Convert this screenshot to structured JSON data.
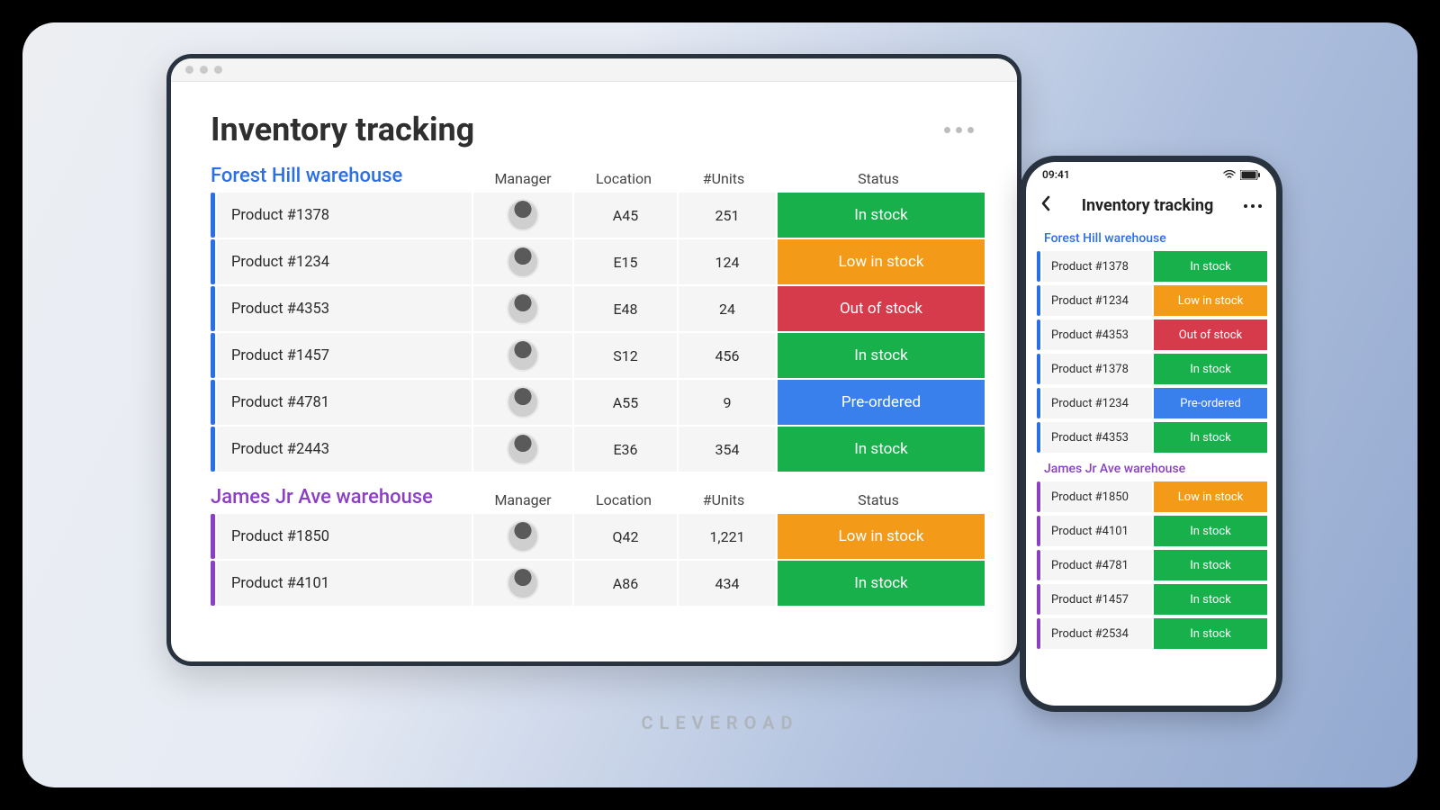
{
  "desktop": {
    "title": "Inventory tracking",
    "columns": {
      "manager": "Manager",
      "location": "Location",
      "units": "#Units",
      "status": "Status"
    },
    "sections": [
      {
        "title": "Forest Hill warehouse",
        "accent": "blue",
        "rows": [
          {
            "name": "Product  #1378",
            "location": "A45",
            "units": "251",
            "status": "In stock",
            "status_class": "instock"
          },
          {
            "name": "Product  #1234",
            "location": "E15",
            "units": "124",
            "status": "Low in stock",
            "status_class": "low"
          },
          {
            "name": "Product  #4353",
            "location": "E48",
            "units": "24",
            "status": "Out of stock",
            "status_class": "out"
          },
          {
            "name": "Product  #1457",
            "location": "S12",
            "units": "456",
            "status": "In stock",
            "status_class": "instock"
          },
          {
            "name": "Product  #4781",
            "location": "A55",
            "units": "9",
            "status": "Pre-ordered",
            "status_class": "pre"
          },
          {
            "name": "Product  #2443",
            "location": "E36",
            "units": "354",
            "status": "In stock",
            "status_class": "instock"
          }
        ]
      },
      {
        "title": "James Jr Ave warehouse",
        "accent": "purple",
        "rows": [
          {
            "name": "Product  #1850",
            "location": "Q42",
            "units": "1,221",
            "status": "Low in stock",
            "status_class": "low"
          },
          {
            "name": "Product  #4101",
            "location": "A86",
            "units": "434",
            "status": "In stock",
            "status_class": "instock"
          }
        ]
      }
    ]
  },
  "phone": {
    "time": "09:41",
    "title": "Inventory tracking",
    "sections": [
      {
        "title": "Forest Hill warehouse",
        "accent": "blue",
        "rows": [
          {
            "name": "Product #1378",
            "status": "In stock",
            "status_class": "instock"
          },
          {
            "name": "Product  #1234",
            "status": "Low in stock",
            "status_class": "low"
          },
          {
            "name": "Product  #4353",
            "status": "Out of stock",
            "status_class": "out"
          },
          {
            "name": "Product #1378",
            "status": "In stock",
            "status_class": "instock"
          },
          {
            "name": "Product  #1234",
            "status": "Pre-ordered",
            "status_class": "pre"
          },
          {
            "name": "Product  #4353",
            "status": "In stock",
            "status_class": "instock"
          }
        ]
      },
      {
        "title": "James Jr Ave warehouse",
        "accent": "purple",
        "rows": [
          {
            "name": "Product  #1850",
            "status": "Low in stock",
            "status_class": "low"
          },
          {
            "name": "Product  #4101",
            "status": "In stock",
            "status_class": "instock"
          },
          {
            "name": "Product  #4781",
            "status": "In stock",
            "status_class": "instock"
          },
          {
            "name": "Product  #1457",
            "status": "In stock",
            "status_class": "instock"
          },
          {
            "name": "Product  #2534",
            "status": "In stock",
            "status_class": "instock"
          }
        ]
      }
    ]
  },
  "brand": "CLEVEROAD"
}
